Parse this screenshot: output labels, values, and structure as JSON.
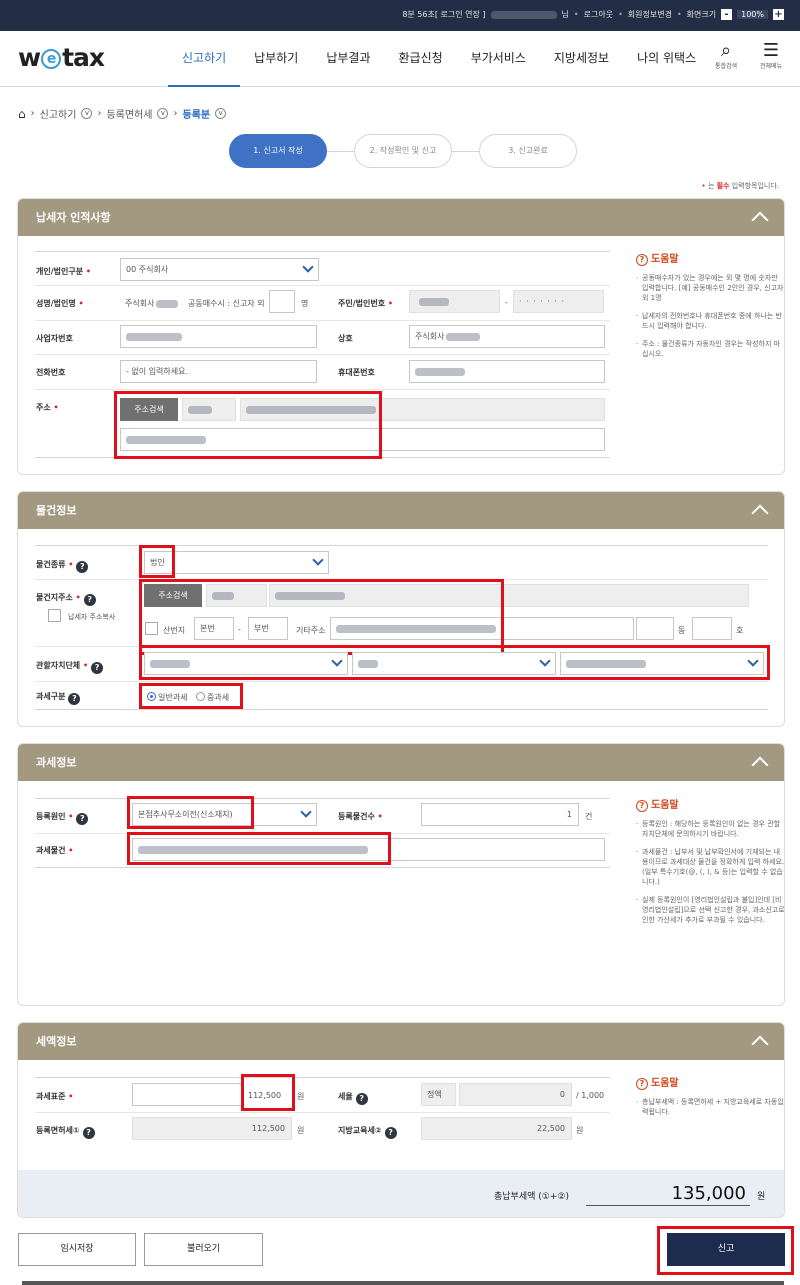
{
  "topbar": {
    "session": "8분 56초[ 로그인 연장 ]",
    "user_suffix": "님",
    "logout": "로그아웃",
    "member_change": "회원정보변경",
    "screen_size": "화면크기",
    "zoom_minus": "-",
    "zoom": "100%",
    "zoom_plus": "+"
  },
  "header": {
    "logo_pre": "w",
    "logo_e": "e",
    "logo_post": "tax",
    "nav": [
      "신고하기",
      "납부하기",
      "납부결과",
      "환급신청",
      "부가서비스",
      "지방세정보",
      "나의 위택스"
    ],
    "search_label": "통합검색",
    "menu_label": "전체메뉴"
  },
  "breadcrumb": {
    "home": "⌂",
    "level1": "신고하기",
    "level2": "등록면허세",
    "level3": "등록분"
  },
  "steps": [
    "1. 신고서 작성",
    "2. 작성확인 및 신고",
    "3. 신고완료"
  ],
  "req_note": {
    "bullet": "•",
    "pre": "는 ",
    "bold": "필수",
    "post": " 입력항목입니다."
  },
  "taxpayer": {
    "title": "납세자 인적사항",
    "type_label": "개인/법인구분",
    "type_value": "00 주식회사",
    "name_label": "성명/법인명",
    "name_value": "주식회사",
    "co_owner_label": "공동매수시 : 신고자 외",
    "co_owner_unit": "명",
    "regno_label": "주민/법인번호",
    "regno_dash": "-",
    "regno_mask": "· · · · · · ·",
    "bizno_label": "사업자번호",
    "company_label": "상호",
    "company_value": "주식회사",
    "phone_label": "전화번호",
    "phone_placeholder": "- 없이 입력하세요.",
    "mobile_label": "휴대폰번호",
    "address_label": "주소",
    "address_button": "주소검색",
    "help_title": "도움말",
    "help": [
      "공동매수자가 있는 경우에는 외 몇 명에 숫자만 입력합니다. [예] 공동매수인 2인인 경우, 신고자 외 1명",
      "납세자의 전화번호나 휴대폰번호 중에 하나는 반드시 입력해야 합니다.",
      "주소 : 물건종류가 자동차인 경우는 작성하지 마십시오."
    ]
  },
  "property": {
    "title": "물건정보",
    "kind_label": "물건종류",
    "kind_value": "법인",
    "addr_label": "물건지주소",
    "copy_label": "납세자 주소복사",
    "addr_button": "주소검색",
    "mountain": "산번지",
    "main_no": "본번",
    "dash": "-",
    "sub_no": "부번",
    "other_addr": "기타주소",
    "dong": "동",
    "ho": "호",
    "gov_label": "관할자치단체",
    "taxtype_label": "과세구분",
    "taxtype_general": "일반과세",
    "taxtype_heavy": "중과세"
  },
  "taxation": {
    "title": "과세정보",
    "cause_label": "등록원인",
    "cause_value": "본점추사무소이전(신소재지)",
    "count_label": "등록물건수",
    "count_value": "1",
    "count_unit": "건",
    "object_label": "과세물건",
    "help_title": "도움말",
    "help": [
      "등록원인 : 해당하는 등록원인이 없는 경우 관할자치단체에 문의하시기 바랍니다.",
      "과세물건 : 납부서 및 납부확인서에 기재되는 내용이므로 과세대상 물건을 정확하게 입력 하세요. (일부 특수기호(@, (, ), & 등)는 입력할 수 없습니다.)",
      "실제 등록원인이 [영리법인설립과 불입]인데 [비영리법인설립]으로 선택 신고한 경우, 과소신고로 인한 가산세가 추가로 부과될 수 있습니다."
    ]
  },
  "amount": {
    "title": "세액정보",
    "base_label": "과세표준",
    "base_value": "112,500",
    "won": "원",
    "rate_label": "세율",
    "rate_type": "정액",
    "rate_value": "0",
    "rate_unit": "/ 1,000",
    "reg_tax_label": "등록면허세①",
    "reg_tax_value": "112,500",
    "edu_tax_label": "지방교육세②",
    "edu_tax_value": "22,500",
    "total_label": "총납부세액 (①+②)",
    "total_value": "135,000",
    "help_title": "도움말",
    "help": [
      "총납부세액 : 등록면허세 + 지방교육세로 자동입력됩니다."
    ]
  },
  "buttons": {
    "temp_save": "임시저장",
    "load": "불러오기",
    "submit": "신고"
  }
}
